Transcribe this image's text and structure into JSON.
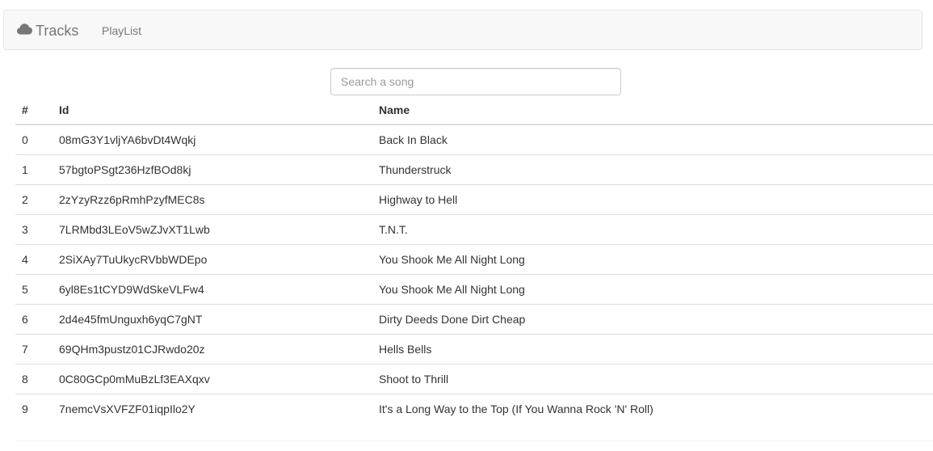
{
  "navbar": {
    "brand_label": "Tracks",
    "brand_icon": "cloud-icon",
    "playlist_label": "PlayList"
  },
  "search": {
    "placeholder": "Search a song",
    "value": ""
  },
  "table": {
    "headers": [
      "#",
      "Id",
      "Name"
    ],
    "rows": [
      {
        "idx": "0",
        "id": "08mG3Y1vljYA6bvDt4Wqkj",
        "name": "Back In Black"
      },
      {
        "idx": "1",
        "id": "57bgtoPSgt236HzfBOd8kj",
        "name": "Thunderstruck"
      },
      {
        "idx": "2",
        "id": "2zYzyRzz6pRmhPzyfMEC8s",
        "name": "Highway to Hell"
      },
      {
        "idx": "3",
        "id": "7LRMbd3LEoV5wZJvXT1Lwb",
        "name": "T.N.T."
      },
      {
        "idx": "4",
        "id": "2SiXAy7TuUkycRVbbWDEpo",
        "name": "You Shook Me All Night Long"
      },
      {
        "idx": "5",
        "id": "6yl8Es1tCYD9WdSkeVLFw4",
        "name": "You Shook Me All Night Long"
      },
      {
        "idx": "6",
        "id": "2d4e45fmUnguxh6yqC7gNT",
        "name": "Dirty Deeds Done Dirt Cheap"
      },
      {
        "idx": "7",
        "id": "69QHm3pustz01CJRwdo20z",
        "name": "Hells Bells"
      },
      {
        "idx": "8",
        "id": "0C80GCp0mMuBzLf3EAXqxv",
        "name": "Shoot to Thrill"
      },
      {
        "idx": "9",
        "id": "7nemcVsXVFZF01iqpIlo2Y",
        "name": "It's a Long Way to the Top (If You Wanna Rock 'N' Roll)"
      }
    ]
  }
}
